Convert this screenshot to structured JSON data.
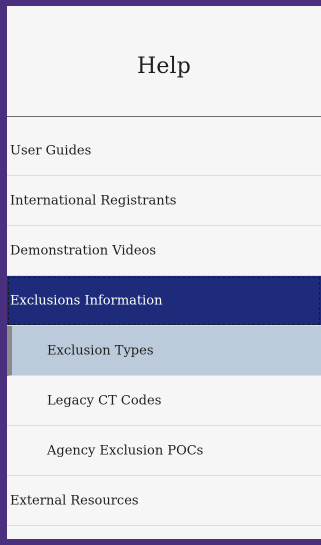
{
  "header": {
    "title": "Help"
  },
  "nav": {
    "items": [
      {
        "label": "User Guides"
      },
      {
        "label": "International Registrants"
      },
      {
        "label": "Demonstration Videos"
      },
      {
        "label": "Exclusions Information"
      },
      {
        "label": "Exclusion Types"
      },
      {
        "label": "Legacy CT Codes"
      },
      {
        "label": "Agency Exclusion POCs"
      },
      {
        "label": "External Resources"
      }
    ]
  },
  "colors": {
    "frame": "#4b2f7f",
    "active_parent": "#1d2b7a",
    "selected": "#bccbdb"
  }
}
